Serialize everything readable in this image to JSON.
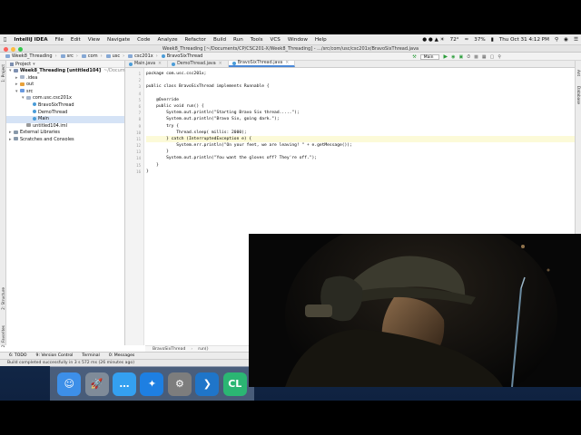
{
  "menubar": {
    "app": "IntelliJ IDEA",
    "items": [
      "File",
      "Edit",
      "View",
      "Navigate",
      "Code",
      "Analyze",
      "Refactor",
      "Build",
      "Run",
      "Tools",
      "VCS",
      "Window",
      "Help"
    ],
    "temperature": "72°",
    "battery": "37%",
    "clock": "Thu Oct 31  4:12 PM"
  },
  "window": {
    "title": "Week8_Threading [~/Documents/CP/CSC201-X/Week8_Threading] - .../src/com/usc/csc201x/BravoSixThread.java"
  },
  "navbar": {
    "crumbs": [
      "Week8_Threading",
      "src",
      "com",
      "usc",
      "csc201x",
      "BravoSixThread"
    ],
    "run_config": "Main"
  },
  "project": {
    "header": "Project",
    "tree": [
      {
        "label": "Week8_Threading [untitled104]",
        "extra": "~/Documents/CP/CSC",
        "level": 0,
        "kind": "module"
      },
      {
        "label": ".idea",
        "level": 1,
        "kind": "folder"
      },
      {
        "label": "out",
        "level": 1,
        "kind": "folder-orange"
      },
      {
        "label": "src",
        "level": 1,
        "kind": "folder-blue"
      },
      {
        "label": "com.usc.csc201x",
        "level": 2,
        "kind": "package"
      },
      {
        "label": "BravoSixThread",
        "level": 3,
        "kind": "class"
      },
      {
        "label": "DemoThread",
        "level": 3,
        "kind": "class"
      },
      {
        "label": "Main",
        "level": 3,
        "kind": "class",
        "selected": true
      },
      {
        "label": "untitled104.iml",
        "level": 2,
        "kind": "file"
      },
      {
        "label": "External Libraries",
        "level": 0,
        "kind": "lib"
      },
      {
        "label": "Scratches and Consoles",
        "level": 0,
        "kind": "scratch"
      }
    ]
  },
  "tabs": [
    {
      "label": "Main.java",
      "active": false
    },
    {
      "label": "DemoThread.java",
      "active": false
    },
    {
      "label": "BravoSixThread.java",
      "active": true
    }
  ],
  "code": [
    "package com.usc.csc201x;",
    "",
    "public class BravoSixThread implements Runnable {",
    "",
    "    @Override",
    "    public void run() {",
    "        System.out.println(\"Starting Bravo Six thread.....\");",
    "        System.out.println(\"Bravo Six, going dark.\");",
    "        try {",
    "            Thread.sleep( millis: 2000);",
    "        } catch (InterruptedException e) {",
    "            System.err.println(\"On your feet, we are leaving! \" + e.getMessage());",
    "        }",
    "        System.out.println(\"You want the gloves off? They're off.\");",
    "    }",
    "}"
  ],
  "line_numbers": [
    "1",
    "2",
    "3",
    "4",
    "5",
    "6",
    "7",
    "8",
    "9",
    "10",
    "11",
    "12",
    "13",
    "14",
    "15",
    "16"
  ],
  "editor_crumbs": [
    "BravoSixThread",
    "run()"
  ],
  "bottom_tools": [
    "6: TODO",
    "9: Version Control",
    "Terminal",
    "0: Messages"
  ],
  "status": "Build completed successfully in 3 s 572 ms (26 minutes ago)",
  "side_labels": {
    "left_top": "1: Project",
    "left_mid": "2: Structure",
    "left_bot": "2: Favorites",
    "right_top": "Ant",
    "right_mid": "Database"
  },
  "dock": [
    {
      "name": "Finder",
      "color": "#3d8fe8"
    },
    {
      "name": "Launchpad",
      "color": "#7f8b99"
    },
    {
      "name": "Messages",
      "color": "#34a0f0"
    },
    {
      "name": "Safari",
      "color": "#1e7fe2"
    },
    {
      "name": "System Preferences",
      "color": "#7d7d7d"
    },
    {
      "name": "Visual Studio Code",
      "color": "#1f75c9"
    },
    {
      "name": "CLion",
      "color": "#2bb673"
    }
  ]
}
